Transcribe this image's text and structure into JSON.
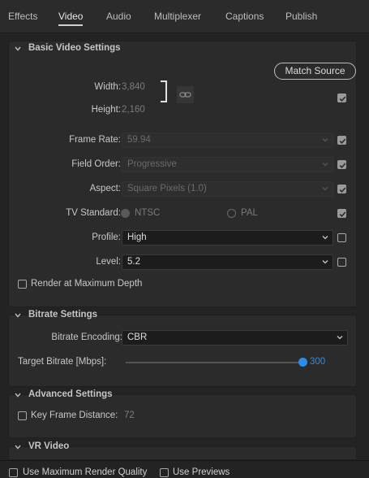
{
  "tabs": [
    {
      "label": "Effects",
      "active": false
    },
    {
      "label": "Video",
      "active": true
    },
    {
      "label": "Audio",
      "active": false
    },
    {
      "label": "Multiplexer",
      "active": false
    },
    {
      "label": "Captions",
      "active": false
    },
    {
      "label": "Publish",
      "active": false
    }
  ],
  "basic_video": {
    "title": "Basic Video Settings",
    "match_source_label": "Match Source",
    "width_label": "Width:",
    "width_value": "3,840",
    "height_label": "Height:",
    "height_value": "2,160",
    "dimensions_override_checked": true,
    "frame_rate_label": "Frame Rate:",
    "frame_rate_value": "59.94",
    "frame_rate_checked": true,
    "field_order_label": "Field Order:",
    "field_order_value": "Progressive",
    "field_order_checked": true,
    "aspect_label": "Aspect:",
    "aspect_value": "Square Pixels (1.0)",
    "aspect_checked": true,
    "tv_standard_label": "TV Standard:",
    "tv_standard_ntsc": "NTSC",
    "tv_standard_pal": "PAL",
    "tv_standard_selected": "NTSC",
    "tv_standard_checked": true,
    "profile_label": "Profile:",
    "profile_value": "High",
    "profile_checked": false,
    "level_label": "Level:",
    "level_value": "5.2",
    "level_checked": false,
    "render_max_depth_label": "Render at Maximum Depth",
    "render_max_depth_checked": false
  },
  "bitrate": {
    "title": "Bitrate Settings",
    "encoding_label": "Bitrate Encoding:",
    "encoding_value": "CBR",
    "target_label": "Target Bitrate [Mbps]:",
    "target_value": "300",
    "target_slider_fraction": 1.0
  },
  "advanced": {
    "title": "Advanced Settings",
    "key_frame_label": "Key Frame Distance:",
    "key_frame_value": "72",
    "key_frame_checked": false
  },
  "vr": {
    "title": "VR Video"
  },
  "bottom": {
    "max_render_quality_label": "Use Maximum Render Quality",
    "max_render_quality_checked": false,
    "use_previews_label": "Use Previews",
    "use_previews_checked": false
  },
  "colors": {
    "accent": "#2d8ceb",
    "panel": "#2b2b2b",
    "background": "#232323"
  }
}
